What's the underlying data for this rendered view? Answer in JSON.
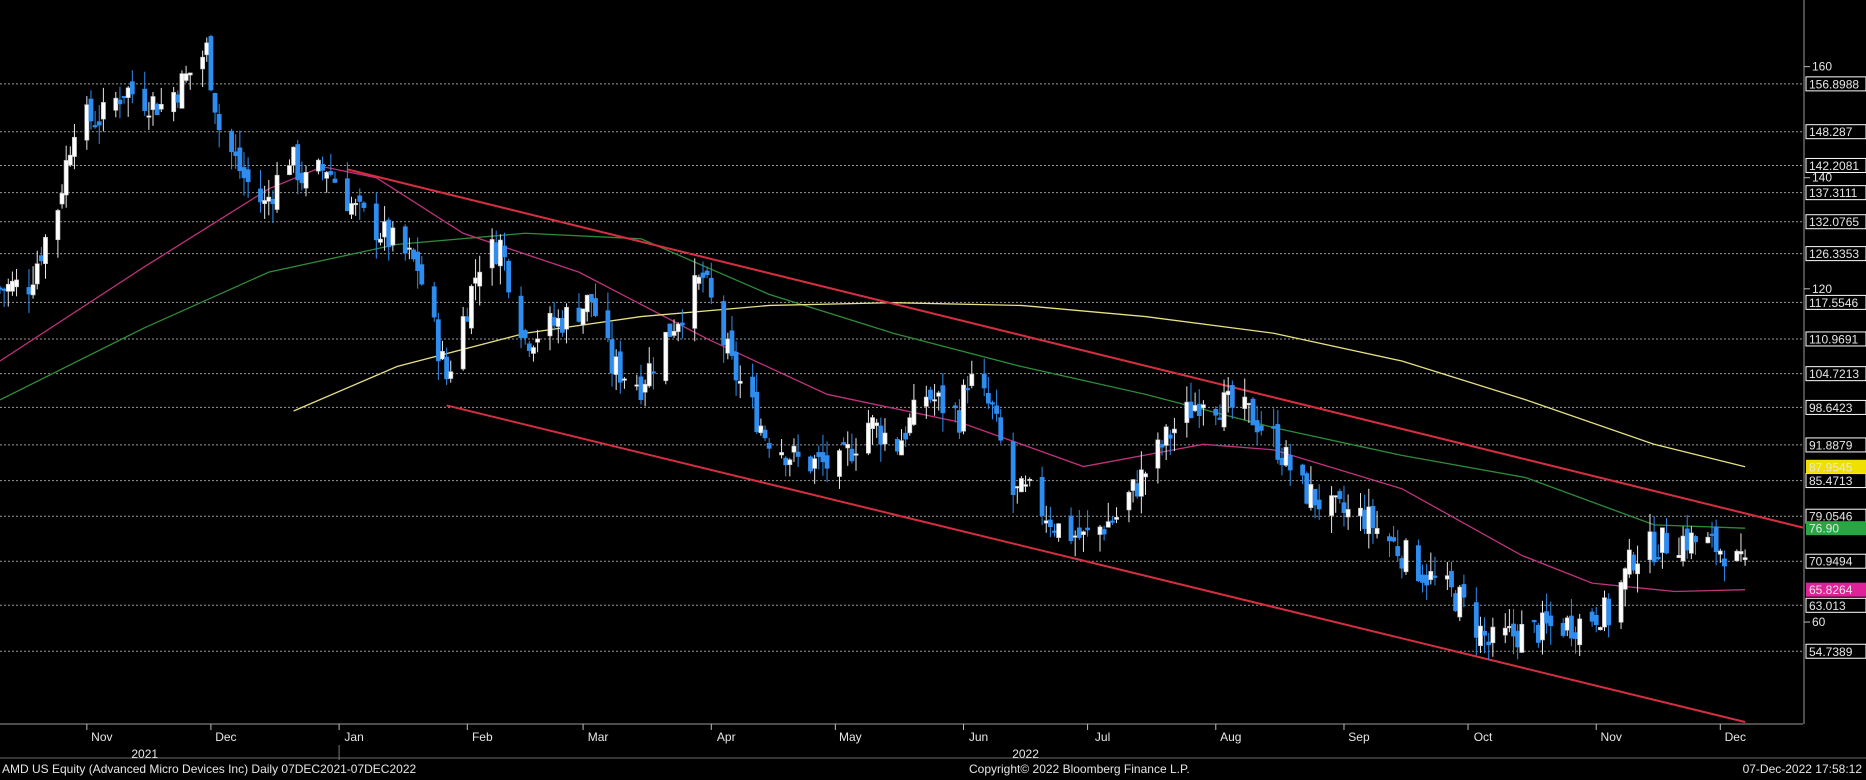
{
  "chart_data": {
    "type": "candlestick",
    "title": "",
    "y_scale": "linear",
    "ylim": [
      42,
      172
    ],
    "xlim": [
      "2021-10-11",
      "2022-12-21"
    ],
    "grid": "horizontal dotted lines at reference price levels",
    "y_ticks": [
      60,
      120,
      140,
      160
    ],
    "x_month_labels": [
      {
        "label": "Nov",
        "date": "2021-11-01"
      },
      {
        "label": "Dec",
        "date": "2021-12-01"
      },
      {
        "label": "Jan",
        "date": "2022-01-01"
      },
      {
        "label": "Feb",
        "date": "2022-02-01"
      },
      {
        "label": "Mar",
        "date": "2022-03-01"
      },
      {
        "label": "Apr",
        "date": "2022-04-01"
      },
      {
        "label": "May",
        "date": "2022-05-01"
      },
      {
        "label": "Jun",
        "date": "2022-06-01"
      },
      {
        "label": "Jul",
        "date": "2022-07-01"
      },
      {
        "label": "Aug",
        "date": "2022-08-01"
      },
      {
        "label": "Sep",
        "date": "2022-09-01"
      },
      {
        "label": "Oct",
        "date": "2022-10-01"
      },
      {
        "label": "Nov",
        "date": "2022-11-01"
      },
      {
        "label": "Dec",
        "date": "2022-12-01"
      }
    ],
    "year_labels": [
      {
        "label": "2021",
        "date": "2021-11-15"
      },
      {
        "label": "2022",
        "date": "2022-06-16"
      }
    ],
    "reference_levels": [
      {
        "label": "156.8988",
        "value": 156.8988
      },
      {
        "label": "148.287",
        "value": 148.287
      },
      {
        "label": "142.2081",
        "value": 142.2081
      },
      {
        "label": "137.3111",
        "value": 137.3111
      },
      {
        "label": "132.0765",
        "value": 132.0765
      },
      {
        "label": "126.3353",
        "value": 126.3353
      },
      {
        "label": "117.5546",
        "value": 117.5546
      },
      {
        "label": "110.9691",
        "value": 110.9691
      },
      {
        "label": "104.7213",
        "value": 104.7213
      },
      {
        "label": "98.6423",
        "value": 98.6423
      },
      {
        "label": "91.8879",
        "value": 91.8879
      },
      {
        "label": "85.4713",
        "value": 85.4713
      },
      {
        "label": "79.0546",
        "value": 79.0546
      },
      {
        "label": "70.9494",
        "value": 70.9494
      },
      {
        "label": "63.013",
        "value": 63.013
      },
      {
        "label": "54.7389",
        "value": 54.7389
      }
    ],
    "last_value_tags": [
      {
        "label": "87.9545",
        "value": 87.9545,
        "color": "#f0e000",
        "text_color": "#000000"
      },
      {
        "label": "76.90",
        "value": 76.9,
        "color": "#27a643",
        "text_color": "#ffffff"
      },
      {
        "label": "65.8264",
        "value": 65.8264,
        "color": "#e0219a",
        "text_color": "#ffffff"
      }
    ],
    "anchors": [
      [
        "2021-10-11",
        120
      ],
      [
        "2021-10-18",
        121
      ],
      [
        "2021-10-25",
        135
      ],
      [
        "2021-10-29",
        150
      ],
      [
        "2021-11-05",
        151
      ],
      [
        "2021-11-10",
        156
      ],
      [
        "2021-11-19",
        153
      ],
      [
        "2021-11-24",
        157
      ],
      [
        "2021-11-30",
        163
      ],
      [
        "2021-12-03",
        149
      ],
      [
        "2021-12-09",
        140
      ],
      [
        "2021-12-14",
        135
      ],
      [
        "2021-12-20",
        144
      ],
      [
        "2021-12-24",
        139
      ],
      [
        "2021-12-29",
        142
      ],
      [
        "2022-01-05",
        134
      ],
      [
        "2022-01-10",
        131
      ],
      [
        "2022-01-20",
        124
      ],
      [
        "2022-01-27",
        104
      ],
      [
        "2022-02-04",
        125
      ],
      [
        "2022-02-09",
        128
      ],
      [
        "2022-02-15",
        111
      ],
      [
        "2022-02-23",
        114
      ],
      [
        "2022-03-03",
        118
      ],
      [
        "2022-03-08",
        106
      ],
      [
        "2022-03-15",
        103
      ],
      [
        "2022-03-23",
        114
      ],
      [
        "2022-03-30",
        122
      ],
      [
        "2022-04-06",
        106
      ],
      [
        "2022-04-14",
        94
      ],
      [
        "2022-04-22",
        89
      ],
      [
        "2022-05-02",
        88
      ],
      [
        "2022-05-09",
        96
      ],
      [
        "2022-05-16",
        92
      ],
      [
        "2022-05-23",
        101
      ],
      [
        "2022-05-31",
        97
      ],
      [
        "2022-06-02",
        104
      ],
      [
        "2022-06-08",
        98
      ],
      [
        "2022-06-13",
        83
      ],
      [
        "2022-06-17",
        83
      ],
      [
        "2022-06-24",
        77
      ],
      [
        "2022-06-30",
        75
      ],
      [
        "2022-07-08",
        79
      ],
      [
        "2022-07-14",
        86
      ],
      [
        "2022-07-21",
        94
      ],
      [
        "2022-07-29",
        101
      ],
      [
        "2022-08-03",
        99
      ],
      [
        "2022-08-10",
        97
      ],
      [
        "2022-08-15",
        93
      ],
      [
        "2022-08-22",
        84
      ],
      [
        "2022-08-29",
        80
      ],
      [
        "2022-09-06",
        79
      ],
      [
        "2022-09-13",
        74
      ],
      [
        "2022-09-20",
        69
      ],
      [
        "2022-09-29",
        64
      ],
      [
        "2022-10-06",
        56
      ],
      [
        "2022-10-13",
        58
      ],
      [
        "2022-10-21",
        59
      ],
      [
        "2022-10-28",
        60
      ],
      [
        "2022-11-02",
        62
      ],
      [
        "2022-11-04",
        61
      ],
      [
        "2022-11-10",
        72
      ],
      [
        "2022-11-16",
        74
      ],
      [
        "2022-11-22",
        75
      ],
      [
        "2022-11-28",
        74
      ],
      [
        "2022-12-02",
        73
      ],
      [
        "2022-12-07",
        69
      ]
    ],
    "moving_averages": [
      {
        "color": "#c0327e",
        "points": [
          [
            "2021-10-11",
            107
          ],
          [
            "2021-11-15",
            124
          ],
          [
            "2021-12-15",
            138
          ],
          [
            "2021-12-28",
            142
          ],
          [
            "2022-01-10",
            140
          ],
          [
            "2022-01-31",
            130
          ],
          [
            "2022-02-28",
            123
          ],
          [
            "2022-03-31",
            111
          ],
          [
            "2022-04-29",
            101
          ],
          [
            "2022-05-31",
            96
          ],
          [
            "2022-06-30",
            88
          ],
          [
            "2022-07-29",
            92
          ],
          [
            "2022-08-15",
            91
          ],
          [
            "2022-09-15",
            84
          ],
          [
            "2022-10-14",
            72
          ],
          [
            "2022-10-31",
            67
          ],
          [
            "2022-11-20",
            65.5
          ],
          [
            "2022-12-07",
            65.8264
          ]
        ]
      },
      {
        "color": "#2e8b3a",
        "points": [
          [
            "2021-10-11",
            100
          ],
          [
            "2021-11-15",
            113
          ],
          [
            "2021-12-15",
            123
          ],
          [
            "2022-01-15",
            128
          ],
          [
            "2022-02-15",
            130
          ],
          [
            "2022-03-15",
            129
          ],
          [
            "2022-04-15",
            119
          ],
          [
            "2022-05-15",
            112
          ],
          [
            "2022-06-15",
            106
          ],
          [
            "2022-07-15",
            101
          ],
          [
            "2022-08-15",
            95
          ],
          [
            "2022-09-15",
            90
          ],
          [
            "2022-10-15",
            86
          ],
          [
            "2022-11-15",
            77.5
          ],
          [
            "2022-12-07",
            76.9
          ]
        ]
      },
      {
        "color": "#e6df83",
        "points": [
          [
            "2021-12-21",
            98
          ],
          [
            "2022-01-15",
            106
          ],
          [
            "2022-02-15",
            112
          ],
          [
            "2022-03-15",
            115
          ],
          [
            "2022-04-15",
            117
          ],
          [
            "2022-05-15",
            117.5
          ],
          [
            "2022-06-15",
            117
          ],
          [
            "2022-07-15",
            115
          ],
          [
            "2022-08-15",
            112
          ],
          [
            "2022-09-15",
            107
          ],
          [
            "2022-10-15",
            100
          ],
          [
            "2022-11-15",
            92
          ],
          [
            "2022-12-07",
            87.9545
          ]
        ]
      }
    ],
    "trendlines": [
      {
        "color": "#d32f40",
        "points": [
          [
            "2022-01-03",
            141.5
          ],
          [
            "2022-12-21",
            77
          ]
        ]
      },
      {
        "color": "#d32f40",
        "points": [
          [
            "2022-01-27",
            99
          ],
          [
            "2022-12-07",
            42
          ]
        ]
      }
    ]
  },
  "footer": {
    "left": "AMD US Equity (Advanced Micro Devices Inc)  Daily 07DEC2021-07DEC2022",
    "center": "Copyright© 2022 Bloomberg Finance L.P.",
    "right": "07-Dec-2022 17:58:12"
  }
}
